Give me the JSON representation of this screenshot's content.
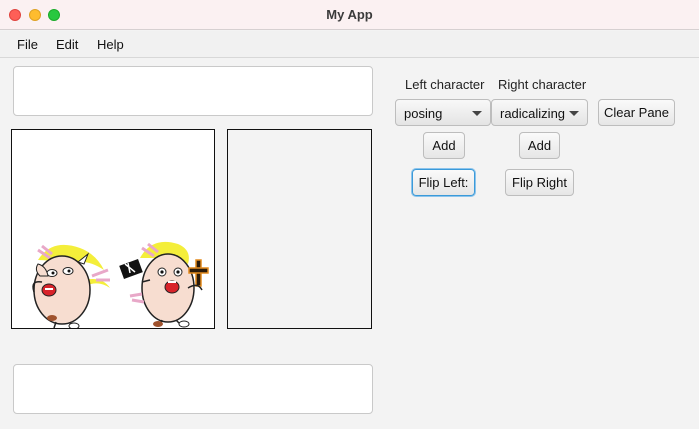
{
  "window": {
    "title": "My App"
  },
  "menu": {
    "file": "File",
    "edit": "Edit",
    "help": "Help"
  },
  "controls": {
    "left_label": "Left character",
    "right_label": "Right character",
    "left_select_value": "posing",
    "right_select_value": "radicalizing",
    "clear_pane": "Clear Pane",
    "add_left": "Add",
    "add_right": "Add",
    "flip_left": "Flip Left:",
    "flip_right": "Flip Right"
  },
  "textboxes": {
    "top_value": "",
    "bottom_value": ""
  },
  "comic": {
    "characters": [
      "posing-character",
      "radicalizing-character"
    ]
  },
  "colors": {
    "titlebar": "#fbf1f2",
    "background": "#f3f3f3",
    "hair": "#f4ee3a",
    "skin": "#f7ddd0",
    "focus": "#3b9ad9"
  }
}
